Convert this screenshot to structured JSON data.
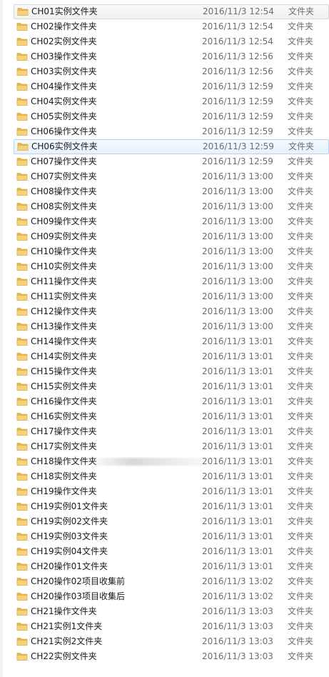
{
  "colors": {
    "folder_body": "#e8b84a",
    "folder_front": "#f5d27a",
    "hover_border": "#d9d9d9",
    "selected_border": "#b9d3f0",
    "meta_text": "#6d6d6d"
  },
  "file_list": {
    "hover_index": 0,
    "selected_index": 9,
    "rows": [
      {
        "icon": "folder-icon",
        "name": "CH01实例文件夹",
        "date": "2016/11/3 12:54",
        "type": "文件夹"
      },
      {
        "icon": "folder-icon",
        "name": "CH02操作文件夹",
        "date": "2016/11/3 12:54",
        "type": "文件夹"
      },
      {
        "icon": "folder-icon",
        "name": "CH02实例文件夹",
        "date": "2016/11/3 12:54",
        "type": "文件夹"
      },
      {
        "icon": "folder-icon",
        "name": "CH03操作文件夹",
        "date": "2016/11/3 12:56",
        "type": "文件夹"
      },
      {
        "icon": "folder-icon",
        "name": "CH03实例文件夹",
        "date": "2016/11/3 12:56",
        "type": "文件夹"
      },
      {
        "icon": "folder-icon",
        "name": "CH04操作文件夹",
        "date": "2016/11/3 12:59",
        "type": "文件夹"
      },
      {
        "icon": "folder-icon",
        "name": "CH04实例文件夹",
        "date": "2016/11/3 12:59",
        "type": "文件夹"
      },
      {
        "icon": "folder-icon",
        "name": "CH05实例文件夹",
        "date": "2016/11/3 12:59",
        "type": "文件夹"
      },
      {
        "icon": "folder-icon",
        "name": "CH06操作文件夹",
        "date": "2016/11/3 12:59",
        "type": "文件夹"
      },
      {
        "icon": "folder-icon",
        "name": "CH06实例文件夹",
        "date": "2016/11/3 12:59",
        "type": "文件夹"
      },
      {
        "icon": "folder-icon",
        "name": "CH07操作文件夹",
        "date": "2016/11/3 12:59",
        "type": "文件夹"
      },
      {
        "icon": "folder-icon",
        "name": "CH07实例文件夹",
        "date": "2016/11/3 13:00",
        "type": "文件夹"
      },
      {
        "icon": "folder-icon",
        "name": "CH08操作文件夹",
        "date": "2016/11/3 13:00",
        "type": "文件夹"
      },
      {
        "icon": "folder-icon",
        "name": "CH08实例文件夹",
        "date": "2016/11/3 13:00",
        "type": "文件夹"
      },
      {
        "icon": "folder-icon",
        "name": "CH09操作文件夹",
        "date": "2016/11/3 13:00",
        "type": "文件夹"
      },
      {
        "icon": "folder-icon",
        "name": "CH09实例文件夹",
        "date": "2016/11/3 13:00",
        "type": "文件夹"
      },
      {
        "icon": "folder-icon",
        "name": "CH10操作文件夹",
        "date": "2016/11/3 13:00",
        "type": "文件夹"
      },
      {
        "icon": "folder-icon",
        "name": "CH10实例文件夹",
        "date": "2016/11/3 13:00",
        "type": "文件夹"
      },
      {
        "icon": "folder-icon",
        "name": "CH11操作文件夹",
        "date": "2016/11/3 13:00",
        "type": "文件夹"
      },
      {
        "icon": "folder-icon",
        "name": "CH11实例文件夹",
        "date": "2016/11/3 13:00",
        "type": "文件夹"
      },
      {
        "icon": "folder-icon",
        "name": "CH12操作文件夹",
        "date": "2016/11/3 13:00",
        "type": "文件夹"
      },
      {
        "icon": "folder-icon",
        "name": "CH13操作文件夹",
        "date": "2016/11/3 13:00",
        "type": "文件夹"
      },
      {
        "icon": "folder-icon",
        "name": "CH14操作文件夹",
        "date": "2016/11/3 13:01",
        "type": "文件夹"
      },
      {
        "icon": "folder-icon",
        "name": "CH14实例文件夹",
        "date": "2016/11/3 13:01",
        "type": "文件夹"
      },
      {
        "icon": "folder-icon",
        "name": "CH15操作文件夹",
        "date": "2016/11/3 13:01",
        "type": "文件夹"
      },
      {
        "icon": "folder-icon",
        "name": "CH15实例文件夹",
        "date": "2016/11/3 13:01",
        "type": "文件夹"
      },
      {
        "icon": "folder-icon",
        "name": "CH16操作文件夹",
        "date": "2016/11/3 13:01",
        "type": "文件夹"
      },
      {
        "icon": "folder-icon",
        "name": "CH16实例文件夹",
        "date": "2016/11/3 13:01",
        "type": "文件夹"
      },
      {
        "icon": "folder-icon",
        "name": "CH17操作文件夹",
        "date": "2016/11/3 13:01",
        "type": "文件夹"
      },
      {
        "icon": "folder-icon",
        "name": "CH17实例文件夹",
        "date": "2016/11/3 13:01",
        "type": "文件夹"
      },
      {
        "icon": "folder-icon",
        "name": "CH18操作文件夹",
        "date": "2016/11/3 13:01",
        "type": "文件夹"
      },
      {
        "icon": "folder-icon",
        "name": "CH18实例文件夹",
        "date": "2016/11/3 13:01",
        "type": "文件夹"
      },
      {
        "icon": "folder-icon",
        "name": "CH19操作文件夹",
        "date": "2016/11/3 13:01",
        "type": "文件夹"
      },
      {
        "icon": "folder-icon",
        "name": "CH19实例01文件夹",
        "date": "2016/11/3 13:01",
        "type": "文件夹"
      },
      {
        "icon": "folder-icon",
        "name": "CH19实例02文件夹",
        "date": "2016/11/3 13:01",
        "type": "文件夹"
      },
      {
        "icon": "folder-icon",
        "name": "CH19实例03文件夹",
        "date": "2016/11/3 13:01",
        "type": "文件夹"
      },
      {
        "icon": "folder-icon",
        "name": "CH19实例04文件夹",
        "date": "2016/11/3 13:01",
        "type": "文件夹"
      },
      {
        "icon": "folder-icon",
        "name": "CH20操作01文件夹",
        "date": "2016/11/3 13:01",
        "type": "文件夹"
      },
      {
        "icon": "folder-icon",
        "name": "CH20操作02项目收集前",
        "date": "2016/11/3 13:02",
        "type": "文件夹"
      },
      {
        "icon": "folder-icon",
        "name": "CH20操作03项目收集后",
        "date": "2016/11/3 13:02",
        "type": "文件夹"
      },
      {
        "icon": "folder-icon",
        "name": "CH21操作文件夹",
        "date": "2016/11/3 13:03",
        "type": "文件夹"
      },
      {
        "icon": "folder-icon",
        "name": "CH21实例1文件夹",
        "date": "2016/11/3 13:03",
        "type": "文件夹"
      },
      {
        "icon": "folder-icon",
        "name": "CH21实例2文件夹",
        "date": "2016/11/3 13:03",
        "type": "文件夹"
      },
      {
        "icon": "folder-icon",
        "name": "CH22实例文件夹",
        "date": "2016/11/3 13:03",
        "type": "文件夹"
      }
    ]
  }
}
